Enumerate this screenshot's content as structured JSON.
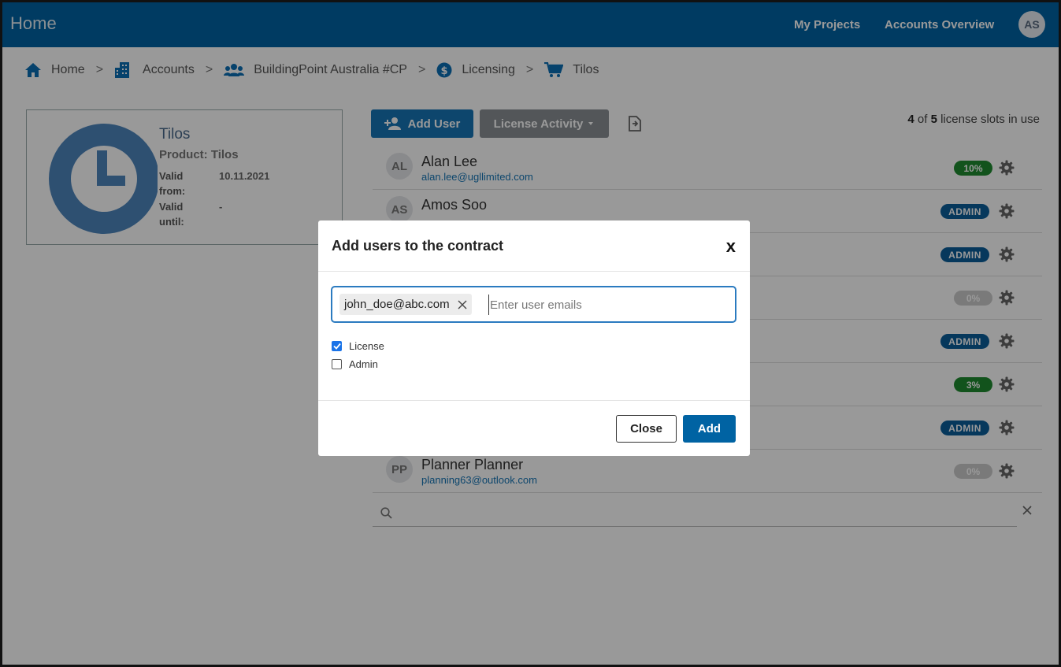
{
  "nav": {
    "logo_alt": "Home",
    "my_projects": "My Projects",
    "accounts_overview": "Accounts Overview",
    "avatar_initials": "AS"
  },
  "breadcrumb": {
    "items": [
      {
        "label": "Home",
        "icon": "home-icon"
      },
      {
        "label": "Accounts",
        "icon": "building-icon"
      },
      {
        "label": "BuildingPoint Australia #CP",
        "icon": "users-icon"
      },
      {
        "label": "Licensing",
        "icon": "dollar-icon"
      },
      {
        "label": "Tilos",
        "icon": "cart-icon"
      }
    ],
    "separator": ">"
  },
  "product_card": {
    "title": "Tilos",
    "product": "Product: Tilos",
    "valid_from_label_1": "Valid",
    "valid_from_label_2": "from:",
    "valid_from_value": "10.11.2021",
    "valid_until_label_1": "Valid",
    "valid_until_label_2": "until:",
    "valid_until_value": "-"
  },
  "toolbar": {
    "add_user": "Add User",
    "license_activity": "License Activity",
    "slots_used": "4",
    "slots_of": "of",
    "slots_total": "5",
    "slots_suffix": "license slots in use"
  },
  "users": [
    {
      "initials": "AL",
      "name": "Alan Lee",
      "email": "alan.lee@ugllimited.com",
      "badge": "10%",
      "badge_type": "green"
    },
    {
      "initials": "AS",
      "name": "Amos Soo",
      "email": "",
      "badge": "ADMIN",
      "badge_type": "admin"
    },
    {
      "initials": "",
      "name": "",
      "email": "",
      "badge": "ADMIN",
      "badge_type": "admin"
    },
    {
      "initials": "",
      "name": "",
      "email": "",
      "badge": "0%",
      "badge_type": "grey"
    },
    {
      "initials": "",
      "name": "",
      "email": "",
      "badge": "ADMIN",
      "badge_type": "admin"
    },
    {
      "initials": "",
      "name": "",
      "email": "",
      "badge": "3%",
      "badge_type": "green"
    },
    {
      "initials": "",
      "name": "",
      "email": "",
      "badge": "ADMIN",
      "badge_type": "admin"
    },
    {
      "initials": "PP",
      "name": "Planner Planner",
      "email": "planning63@outlook.com",
      "badge": "0%",
      "badge_type": "grey"
    }
  ],
  "modal": {
    "title": "Add users to the contract",
    "close_x": "x",
    "chip_email": "john_doe@abc.com",
    "input_placeholder": "Enter user emails",
    "license_label": "License",
    "license_checked": true,
    "admin_label": "Admin",
    "admin_checked": false,
    "close_button": "Close",
    "add_button": "Add"
  }
}
